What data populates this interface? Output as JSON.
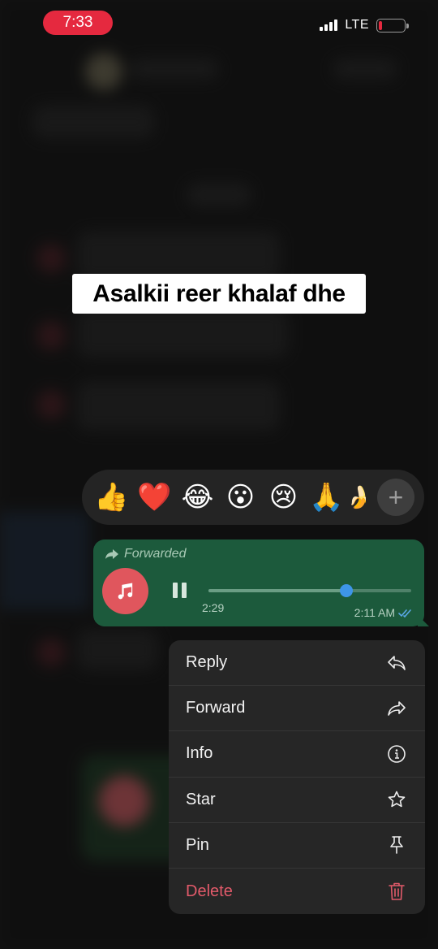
{
  "status_bar": {
    "time": "7:33",
    "network": "LTE",
    "signal_bars": 4,
    "battery_level": 0.1
  },
  "caption": "Asalkii reer khalaf dhe",
  "reactions": {
    "emojis": [
      "👍",
      "❤️",
      "😂",
      "😮",
      "😢",
      "🙏"
    ],
    "partial_emoji": "🍌",
    "more_label": "+"
  },
  "message": {
    "forwarded_label": "Forwarded",
    "duration": "2:29",
    "sent_time": "2:11 AM",
    "read_receipt": "double-check",
    "progress": 0.68
  },
  "menu": {
    "reply": "Reply",
    "forward": "Forward",
    "info": "Info",
    "star": "Star",
    "pin": "Pin",
    "delete": "Delete"
  },
  "colors": {
    "status_pill": "#e5293f",
    "bubble": "#1c5a3c",
    "delete": "#e25a6a",
    "progress_knob": "#3e95e8"
  }
}
